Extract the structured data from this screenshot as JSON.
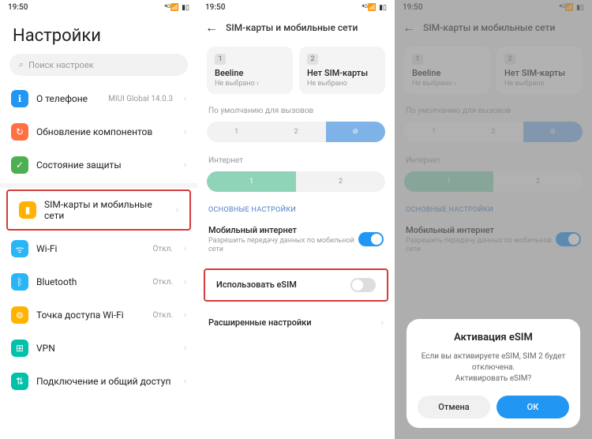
{
  "status": {
    "time": "19:50",
    "signal": "⁴ᴳ📶",
    "battery": "▮▯"
  },
  "screen1": {
    "title": "Настройки",
    "searchPlaceholder": "Поиск настроек",
    "items": [
      {
        "label": "О телефоне",
        "value": "MIUI Global 14.0.3"
      },
      {
        "label": "Обновление компонентов",
        "value": ""
      },
      {
        "label": "Состояние защиты",
        "value": ""
      },
      {
        "label": "SIM-карты и мобильные сети",
        "value": ""
      },
      {
        "label": "Wi-Fi",
        "value": "Откл."
      },
      {
        "label": "Bluetooth",
        "value": "Откл."
      },
      {
        "label": "Точка доступа Wi-Fi",
        "value": "Откл."
      },
      {
        "label": "VPN",
        "value": ""
      },
      {
        "label": "Подключение и общий доступ",
        "value": ""
      }
    ]
  },
  "screen2": {
    "header": "SIM-карты и мобильные сети",
    "sim1": {
      "num": "1",
      "name": "Beeline",
      "sub": "Не выбрано"
    },
    "sim2": {
      "num": "2",
      "name": "Нет SIM-карты",
      "sub": "Не выбрано"
    },
    "defaultCalls": "По умолчанию для вызовов",
    "internet": "Интернет",
    "sectionMain": "ОСНОВНЫЕ НАСТРОЙКИ",
    "mobileData": {
      "title": "Мобильный интернет",
      "sub": "Разрешить передачу данных по мобильной сети"
    },
    "useEsim": "Использовать eSIM",
    "advanced": "Расширенные настройки",
    "seg": {
      "one": "1",
      "two": "2",
      "ban": "⊘"
    }
  },
  "dialog": {
    "title": "Активация eSIM",
    "body1": "Если вы активируете eSIM, SIM 2 будет отключена.",
    "body2": "Активировать eSIM?",
    "cancel": "Отмена",
    "ok": "ОК"
  }
}
